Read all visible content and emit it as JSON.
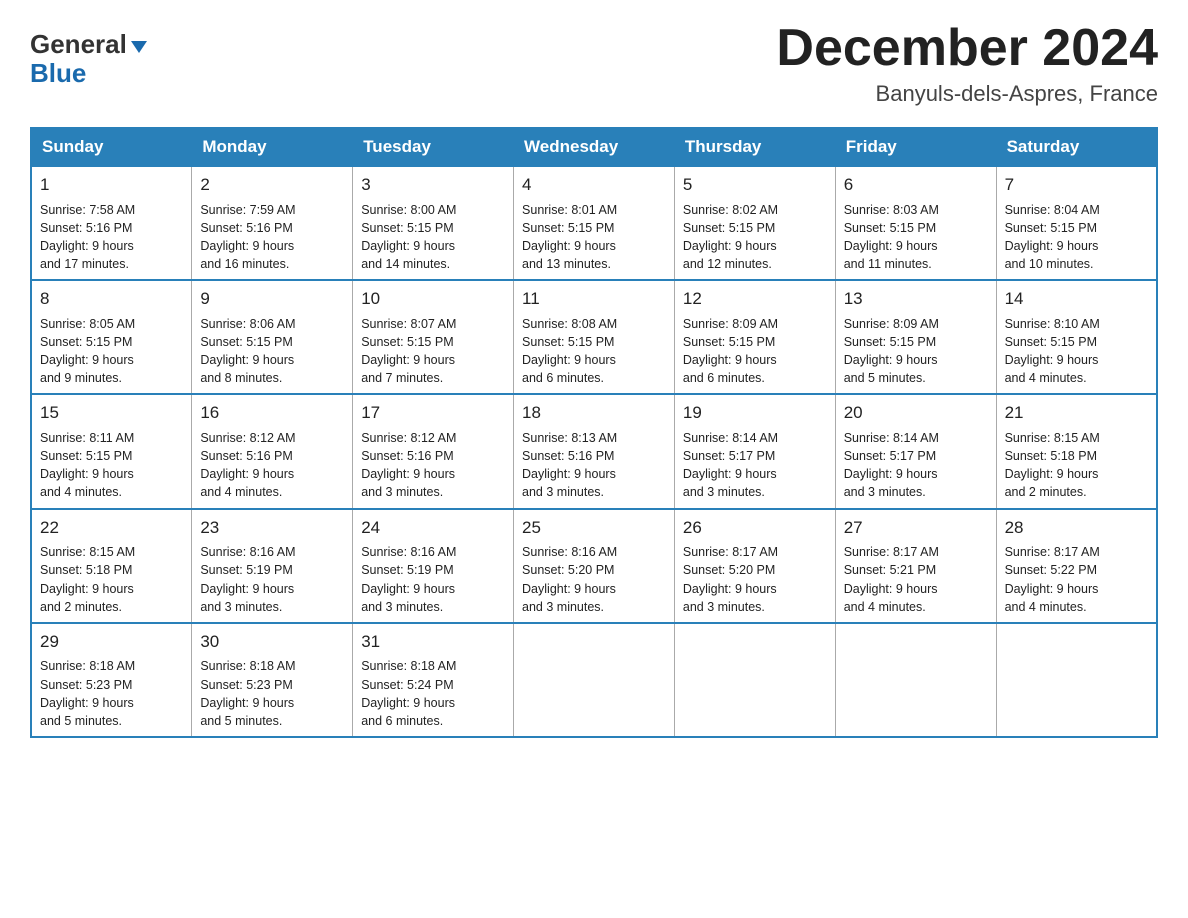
{
  "header": {
    "logo_general": "General",
    "logo_blue": "Blue",
    "month_title": "December 2024",
    "location": "Banyuls-dels-Aspres, France"
  },
  "days_of_week": [
    "Sunday",
    "Monday",
    "Tuesday",
    "Wednesday",
    "Thursday",
    "Friday",
    "Saturday"
  ],
  "weeks": [
    [
      {
        "num": "1",
        "sunrise": "7:58 AM",
        "sunset": "5:16 PM",
        "daylight": "9 hours and 17 minutes."
      },
      {
        "num": "2",
        "sunrise": "7:59 AM",
        "sunset": "5:16 PM",
        "daylight": "9 hours and 16 minutes."
      },
      {
        "num": "3",
        "sunrise": "8:00 AM",
        "sunset": "5:15 PM",
        "daylight": "9 hours and 14 minutes."
      },
      {
        "num": "4",
        "sunrise": "8:01 AM",
        "sunset": "5:15 PM",
        "daylight": "9 hours and 13 minutes."
      },
      {
        "num": "5",
        "sunrise": "8:02 AM",
        "sunset": "5:15 PM",
        "daylight": "9 hours and 12 minutes."
      },
      {
        "num": "6",
        "sunrise": "8:03 AM",
        "sunset": "5:15 PM",
        "daylight": "9 hours and 11 minutes."
      },
      {
        "num": "7",
        "sunrise": "8:04 AM",
        "sunset": "5:15 PM",
        "daylight": "9 hours and 10 minutes."
      }
    ],
    [
      {
        "num": "8",
        "sunrise": "8:05 AM",
        "sunset": "5:15 PM",
        "daylight": "9 hours and 9 minutes."
      },
      {
        "num": "9",
        "sunrise": "8:06 AM",
        "sunset": "5:15 PM",
        "daylight": "9 hours and 8 minutes."
      },
      {
        "num": "10",
        "sunrise": "8:07 AM",
        "sunset": "5:15 PM",
        "daylight": "9 hours and 7 minutes."
      },
      {
        "num": "11",
        "sunrise": "8:08 AM",
        "sunset": "5:15 PM",
        "daylight": "9 hours and 6 minutes."
      },
      {
        "num": "12",
        "sunrise": "8:09 AM",
        "sunset": "5:15 PM",
        "daylight": "9 hours and 6 minutes."
      },
      {
        "num": "13",
        "sunrise": "8:09 AM",
        "sunset": "5:15 PM",
        "daylight": "9 hours and 5 minutes."
      },
      {
        "num": "14",
        "sunrise": "8:10 AM",
        "sunset": "5:15 PM",
        "daylight": "9 hours and 4 minutes."
      }
    ],
    [
      {
        "num": "15",
        "sunrise": "8:11 AM",
        "sunset": "5:15 PM",
        "daylight": "9 hours and 4 minutes."
      },
      {
        "num": "16",
        "sunrise": "8:12 AM",
        "sunset": "5:16 PM",
        "daylight": "9 hours and 4 minutes."
      },
      {
        "num": "17",
        "sunrise": "8:12 AM",
        "sunset": "5:16 PM",
        "daylight": "9 hours and 3 minutes."
      },
      {
        "num": "18",
        "sunrise": "8:13 AM",
        "sunset": "5:16 PM",
        "daylight": "9 hours and 3 minutes."
      },
      {
        "num": "19",
        "sunrise": "8:14 AM",
        "sunset": "5:17 PM",
        "daylight": "9 hours and 3 minutes."
      },
      {
        "num": "20",
        "sunrise": "8:14 AM",
        "sunset": "5:17 PM",
        "daylight": "9 hours and 3 minutes."
      },
      {
        "num": "21",
        "sunrise": "8:15 AM",
        "sunset": "5:18 PM",
        "daylight": "9 hours and 2 minutes."
      }
    ],
    [
      {
        "num": "22",
        "sunrise": "8:15 AM",
        "sunset": "5:18 PM",
        "daylight": "9 hours and 2 minutes."
      },
      {
        "num": "23",
        "sunrise": "8:16 AM",
        "sunset": "5:19 PM",
        "daylight": "9 hours and 3 minutes."
      },
      {
        "num": "24",
        "sunrise": "8:16 AM",
        "sunset": "5:19 PM",
        "daylight": "9 hours and 3 minutes."
      },
      {
        "num": "25",
        "sunrise": "8:16 AM",
        "sunset": "5:20 PM",
        "daylight": "9 hours and 3 minutes."
      },
      {
        "num": "26",
        "sunrise": "8:17 AM",
        "sunset": "5:20 PM",
        "daylight": "9 hours and 3 minutes."
      },
      {
        "num": "27",
        "sunrise": "8:17 AM",
        "sunset": "5:21 PM",
        "daylight": "9 hours and 4 minutes."
      },
      {
        "num": "28",
        "sunrise": "8:17 AM",
        "sunset": "5:22 PM",
        "daylight": "9 hours and 4 minutes."
      }
    ],
    [
      {
        "num": "29",
        "sunrise": "8:18 AM",
        "sunset": "5:23 PM",
        "daylight": "9 hours and 5 minutes."
      },
      {
        "num": "30",
        "sunrise": "8:18 AM",
        "sunset": "5:23 PM",
        "daylight": "9 hours and 5 minutes."
      },
      {
        "num": "31",
        "sunrise": "8:18 AM",
        "sunset": "5:24 PM",
        "daylight": "9 hours and 6 minutes."
      },
      null,
      null,
      null,
      null
    ]
  ],
  "labels": {
    "sunrise": "Sunrise:",
    "sunset": "Sunset:",
    "daylight": "Daylight:"
  }
}
